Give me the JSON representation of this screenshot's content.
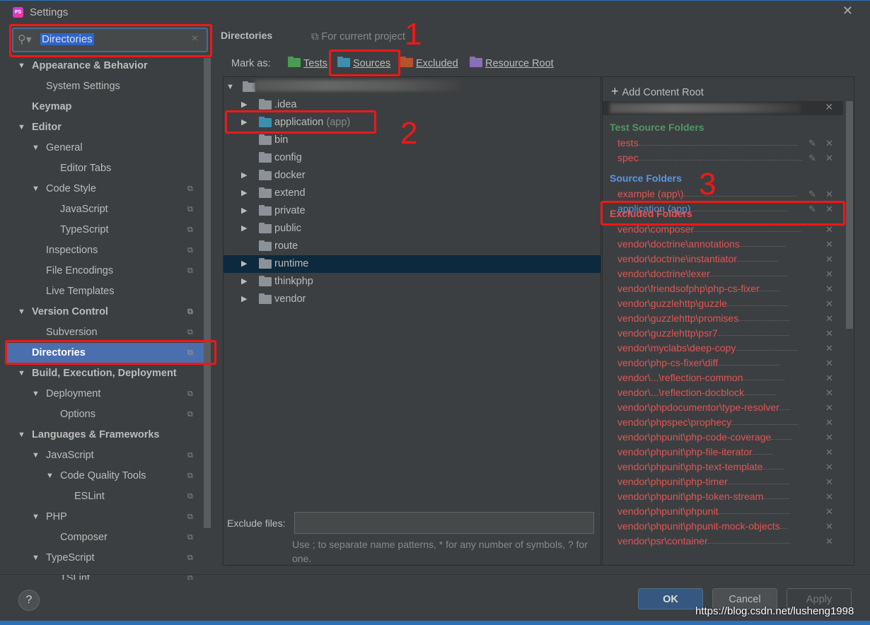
{
  "window": {
    "title": "Settings",
    "app_icon": "PS",
    "close_icon": "close-icon"
  },
  "search": {
    "value": "Directories",
    "icon": "search-icon",
    "clear": "×"
  },
  "sidebar": {
    "items": [
      {
        "label": "Appearance & Behavior",
        "level": 0,
        "bold": true,
        "arrow": "down"
      },
      {
        "label": "System Settings",
        "level": 1
      },
      {
        "label": "Keymap",
        "level": 0,
        "bold": true
      },
      {
        "label": "Editor",
        "level": 0,
        "bold": true,
        "arrow": "down"
      },
      {
        "label": "General",
        "level": 1,
        "arrow": "down"
      },
      {
        "label": "Editor Tabs",
        "level": 2
      },
      {
        "label": "Code Style",
        "level": 1,
        "arrow": "down",
        "copy": true
      },
      {
        "label": "JavaScript",
        "level": 2,
        "copy": true
      },
      {
        "label": "TypeScript",
        "level": 2,
        "copy": true
      },
      {
        "label": "Inspections",
        "level": 1,
        "copy": true
      },
      {
        "label": "File Encodings",
        "level": 1,
        "copy": true
      },
      {
        "label": "Live Templates",
        "level": 1
      },
      {
        "label": "Version Control",
        "level": 0,
        "bold": true,
        "arrow": "down",
        "copy": true
      },
      {
        "label": "Subversion",
        "level": 1,
        "copy": true
      },
      {
        "label": "Directories",
        "level": 0,
        "bold": true,
        "selected": true,
        "copy": true
      },
      {
        "label": "Build, Execution, Deployment",
        "level": 0,
        "bold": true,
        "arrow": "down"
      },
      {
        "label": "Deployment",
        "level": 1,
        "arrow": "down",
        "copy": true
      },
      {
        "label": "Options",
        "level": 2,
        "copy": true
      },
      {
        "label": "Languages & Frameworks",
        "level": 0,
        "bold": true,
        "arrow": "down"
      },
      {
        "label": "JavaScript",
        "level": 1,
        "arrow": "down",
        "copy": true
      },
      {
        "label": "Code Quality Tools",
        "level": 2,
        "arrow": "down",
        "copy": true
      },
      {
        "label": "ESLint",
        "level": 3,
        "copy": true
      },
      {
        "label": "PHP",
        "level": 1,
        "arrow": "down",
        "copy": true
      },
      {
        "label": "Composer",
        "level": 2,
        "copy": true
      },
      {
        "label": "TypeScript",
        "level": 1,
        "arrow": "down",
        "copy": true
      },
      {
        "label": "TSLint",
        "level": 2,
        "copy": true
      }
    ]
  },
  "main": {
    "header": "Directories",
    "scope": "For current project",
    "mark_as_label": "Mark as:",
    "mark_as": [
      {
        "label": "Tests",
        "color": "#499c54"
      },
      {
        "label": "Sources",
        "color": "#3d8fb0"
      },
      {
        "label": "Excluded",
        "color": "#b4542a"
      },
      {
        "label": "Resource Root",
        "color": "#8a6fb8"
      }
    ],
    "tree": [
      {
        "name": ".idea",
        "arrow": true
      },
      {
        "name": "application",
        "suffix": "(app)",
        "arrow": true,
        "source": true
      },
      {
        "name": "bin"
      },
      {
        "name": "config"
      },
      {
        "name": "docker",
        "arrow": true
      },
      {
        "name": "extend",
        "arrow": true
      },
      {
        "name": "private",
        "arrow": true
      },
      {
        "name": "public",
        "arrow": true
      },
      {
        "name": "route"
      },
      {
        "name": "runtime",
        "arrow": true,
        "selected": true
      },
      {
        "name": "thinkphp",
        "arrow": true
      },
      {
        "name": "vendor",
        "arrow": true
      }
    ],
    "exclude_label": "Exclude files:",
    "exclude_value": "",
    "hint": "Use ; to separate name patterns, * for any number of symbols, ? for one."
  },
  "roots": {
    "add_label": "Add Content Root",
    "sections": [
      {
        "title": "Test Source Folders",
        "color": "#4e9a5e",
        "items": [
          {
            "name": "tests",
            "color": "#e05555",
            "edit": true
          },
          {
            "name": "spec",
            "color": "#e05555",
            "edit": true
          }
        ]
      },
      {
        "title": "Source Folders",
        "color": "#5a96e6",
        "items": [
          {
            "name": "example (app\\)",
            "color": "#e05555",
            "edit": true
          },
          {
            "name": "application (app)",
            "color": "#5a96e6",
            "edit": true
          }
        ]
      },
      {
        "title": "Excluded Folders",
        "color": "#e05555",
        "items": [
          "vendor\\composer",
          "vendor\\doctrine\\annotations",
          "vendor\\doctrine\\instantiator",
          "vendor\\doctrine\\lexer",
          "vendor\\friendsofphp\\php-cs-fixer",
          "vendor\\guzzlehttp\\guzzle",
          "vendor\\guzzlehttp\\promises",
          "vendor\\guzzlehttp\\psr7",
          "vendor\\myclabs\\deep-copy",
          "vendor\\php-cs-fixer\\diff",
          "vendor\\...\\reflection-common",
          "vendor\\...\\reflection-docblock",
          "vendor\\phpdocumentor\\type-resolver",
          "vendor\\phpspec\\prophecy",
          "vendor\\phpunit\\php-code-coverage",
          "vendor\\phpunit\\php-file-iterator",
          "vendor\\phpunit\\php-text-template",
          "vendor\\phpunit\\php-timer",
          "vendor\\phpunit\\php-token-stream",
          "vendor\\phpunit\\phpunit",
          "vendor\\phpunit\\phpunit-mock-objects",
          "vendor\\psr\\container"
        ]
      }
    ]
  },
  "footer": {
    "help": "?",
    "ok": "OK",
    "cancel": "Cancel",
    "apply": "Apply"
  },
  "watermark": "https://blog.csdn.net/lusheng1998",
  "annotations": [
    "1",
    "2",
    "3"
  ]
}
